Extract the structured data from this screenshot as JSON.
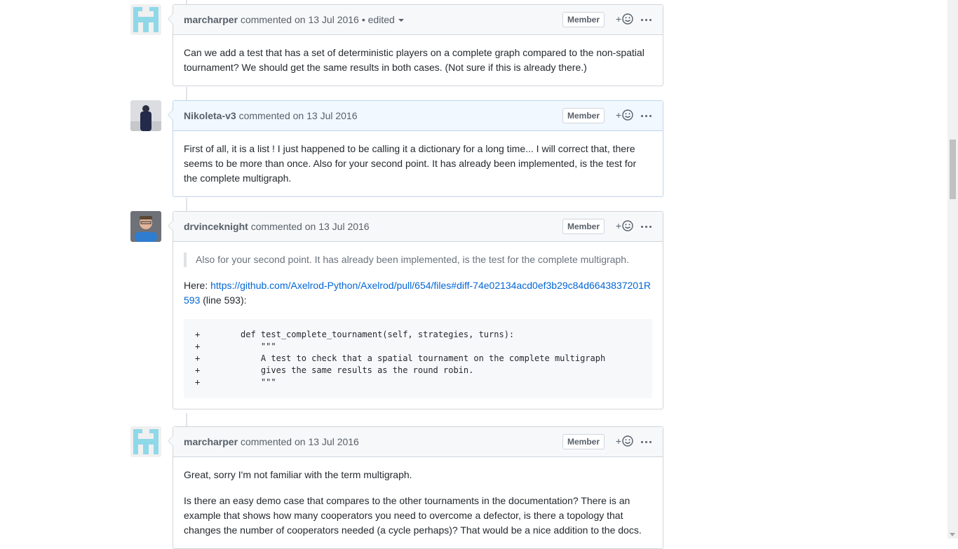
{
  "comments": [
    {
      "author": "marcharper",
      "action": "commented",
      "timestamp": "on 13 Jul 2016",
      "edited": "• edited",
      "badge": "Member",
      "avatar": "identicon-avatar",
      "body": "Can we add a test that has a set of deterministic players on a complete graph compared to the non-spatial tournament? We should get the same results in both cases. (Not sure if this is already there.)"
    },
    {
      "author": "Nikoleta-v3",
      "action": "commented",
      "timestamp": "on 13 Jul 2016",
      "badge": "Member",
      "avatar": "photo-avatar",
      "body": "First of all, it is a list ! I just happened to be calling it a dictionary for a long time... I will correct that, there seems to be more than once. Also for your second point. It has already been implemented, is the test for the complete multigraph."
    },
    {
      "author": "drvinceknight",
      "action": "commented",
      "timestamp": "on 13 Jul 2016",
      "badge": "Member",
      "avatar": "photo-avatar",
      "quote": "Also for your second point. It has already been implemented, is the test for the complete multigraph.",
      "here_prefix": "Here: ",
      "link": "https://github.com/Axelrod-Python/Axelrod/pull/654/files#diff-74e02134acd0ef3b29c84d6643837201R593",
      "here_suffix": " (line 593):",
      "code": "+        def test_complete_tournament(self, strategies, turns):\n+            \"\"\"\n+            A test to check that a spatial tournament on the complete multigraph\n+            gives the same results as the round robin.\n+            \"\"\""
    },
    {
      "author": "marcharper",
      "action": "commented",
      "timestamp": "on 13 Jul 2016",
      "badge": "Member",
      "avatar": "identicon-avatar",
      "body": "Great, sorry I'm not familiar with the term multigraph.",
      "body2": "Is there an easy demo case that compares to the other tournaments in the documentation? There is an example that shows how many cooperators you need to overcome a defector, is there a topology that changes the number of cooperators needed (a cycle perhaps)? That would be a nice addition to the docs."
    }
  ],
  "colors": {
    "link": "#0366d6",
    "identicon": "#8fd8e8",
    "header_bg": "#f6f8fa",
    "highlight_bg": "#f1f8ff"
  }
}
